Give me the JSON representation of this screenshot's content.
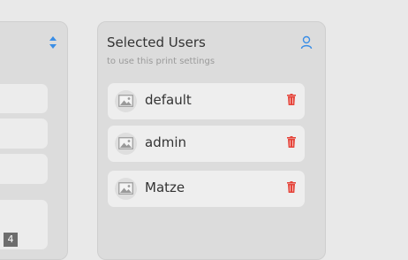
{
  "selected_users": {
    "title": "Selected Users",
    "subtitle": "to use this print settings",
    "icon": "person-icon",
    "users": [
      {
        "name": "default",
        "avatar_icon": "image-placeholder-icon",
        "action_icon": "trash-icon"
      },
      {
        "name": "admin",
        "avatar_icon": "image-placeholder-icon",
        "action_icon": "trash-icon"
      },
      {
        "name": "Matze",
        "avatar_icon": "image-placeholder-icon",
        "action_icon": "trash-icon"
      }
    ]
  },
  "left_panel": {
    "icon": "sort-updown-icon"
  },
  "badge": {
    "label": "4"
  },
  "colors": {
    "accent_blue": "#3b8ee6",
    "delete_red": "#e5443a",
    "panel_bg": "#dcdcdc",
    "card_bg": "#eeeeee"
  }
}
